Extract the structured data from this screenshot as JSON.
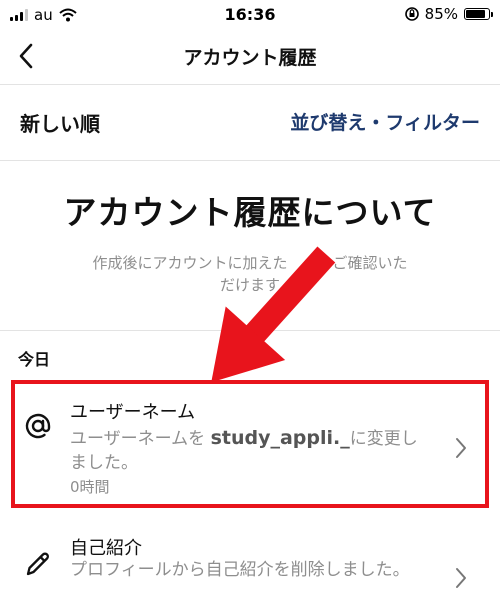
{
  "status_bar": {
    "carrier": "au",
    "time": "16:36",
    "battery": "85%",
    "battery_level": 0.85
  },
  "nav": {
    "title": "アカウント履歴",
    "back_icon": "chevron-left-icon"
  },
  "sort": {
    "label": "新しい順",
    "filter_link": "並び替え・フィルター"
  },
  "about": {
    "title": "アカウント履歴について",
    "description_line1": "作成後にアカウントに加えた　　　ご確認いた",
    "description_line2": "だけます"
  },
  "section": {
    "today": "今日"
  },
  "items": [
    {
      "icon": "at-sign-icon",
      "title": "ユーザーネーム",
      "body_prefix": "ユーザーネームを ",
      "body_value": "study_appli._",
      "body_suffix": "に変更しました。",
      "time": "0時間"
    },
    {
      "icon": "pencil-icon",
      "title": "自己紹介",
      "body": "プロフィールから自己紹介を削除しました。"
    }
  ],
  "colors": {
    "annotation_red": "#e8141c",
    "link_blue": "#1e3a6e",
    "muted_gray": "#8e8e8e"
  }
}
